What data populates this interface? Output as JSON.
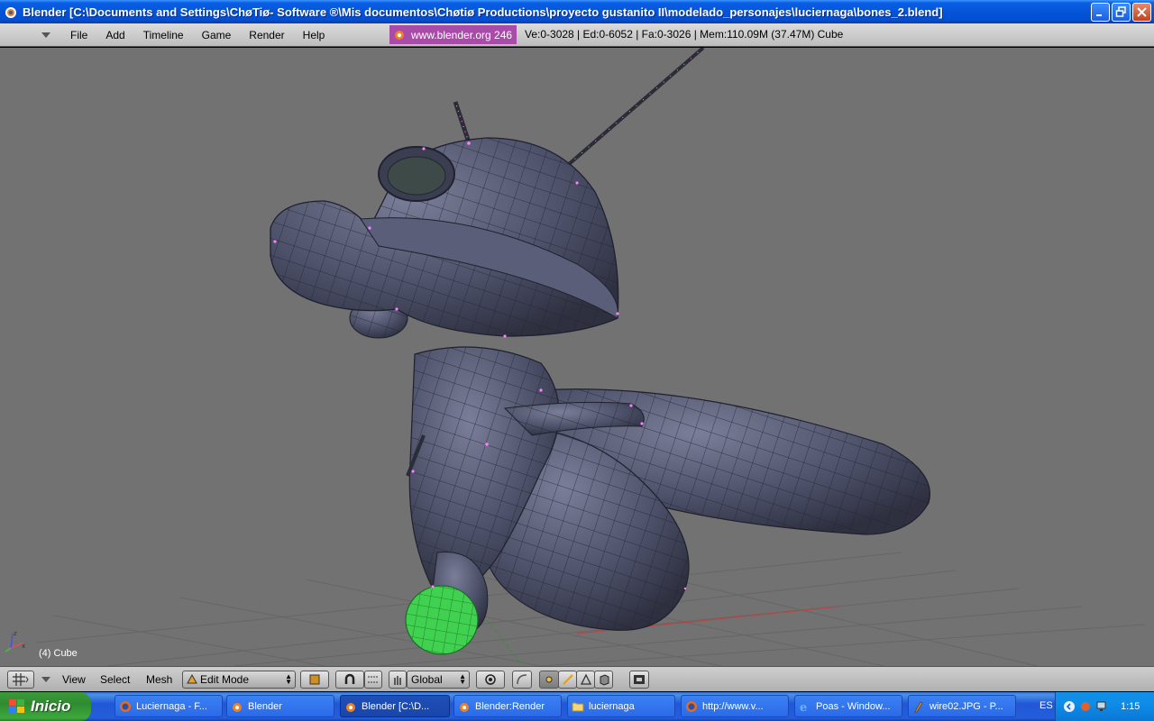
{
  "window": {
    "title": "Blender [C:\\Documents and Settings\\ChøTiø- Software ®\\Mis documentos\\Chøtiø Productions\\proyecto gustanito II\\modelado_personajes\\luciernaga\\bones_2.blend]"
  },
  "menubar": {
    "items": [
      "File",
      "Add",
      "Timeline",
      "Game",
      "Render",
      "Help"
    ],
    "version_label": "www.blender.org 246",
    "stats": "Ve:0-3028 | Ed:0-6052 | Fa:0-3026 | Mem:110.09M (37.47M) Cube"
  },
  "viewport": {
    "background": "#727272",
    "object_label": "(4) Cube",
    "mesh_color": "#4d5066",
    "selected_vertex_color": "#ff80ff",
    "selected_face_color": "#3fd14f"
  },
  "bottom_header": {
    "view_label": "View",
    "select_label": "Select",
    "mesh_label": "Mesh",
    "mode": "Edit Mode",
    "orientation": "Global"
  },
  "taskbar": {
    "start_label": "Inicio",
    "tasks": [
      {
        "label": "Luciernaga - F...",
        "icon": "firefox-icon"
      },
      {
        "label": "Blender",
        "icon": "blender-icon"
      },
      {
        "label": "Blender [C:\\D...",
        "icon": "blender-icon",
        "active": true
      },
      {
        "label": "Blender:Render",
        "icon": "blender-icon"
      },
      {
        "label": "luciernaga",
        "icon": "folder-icon"
      },
      {
        "label": "http://www.v...",
        "icon": "firefox-icon"
      },
      {
        "label": "Poas - Window...",
        "icon": "ie-icon"
      },
      {
        "label": "wire02.JPG - P...",
        "icon": "paint-icon"
      }
    ],
    "language": "ES",
    "clock": "1:15"
  }
}
